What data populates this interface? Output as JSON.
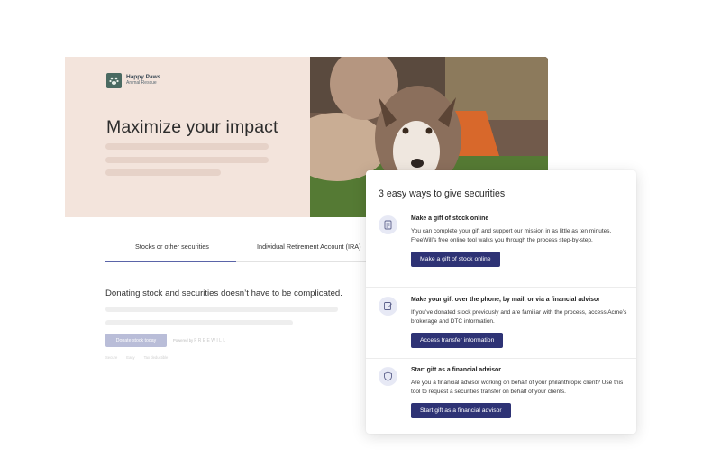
{
  "brand": {
    "name": "Happy Paws",
    "sub": "Animal Rescue"
  },
  "hero": {
    "title": "Maximize your impact"
  },
  "tabs": [
    {
      "label": "Stocks or other securities"
    },
    {
      "label": "Individual Retirement Account (IRA)"
    }
  ],
  "main": {
    "intro": "Donating stock and securities doesn’t have to be complicated.",
    "donate_button": "Donate stock today",
    "powered_prefix": "Powered by",
    "powered_brand": "FREEWILL",
    "footer_links": [
      "Secure",
      "Easy",
      "Tax deductible"
    ]
  },
  "panel": {
    "title": "3 easy ways to give securities",
    "items": [
      {
        "icon": "document-stock-icon",
        "heading": "Make a gift of stock online",
        "description": "You can complete your gift and support our mission in as little as ten minutes. FreeWill’s free online tool walks you through the process step-by-step.",
        "button": "Make a gift of stock online"
      },
      {
        "icon": "edit-document-icon",
        "heading": "Make your gift over the phone, by mail, or via a financial advisor",
        "description": "If you’ve donated stock previously and are familiar with the process, access Acme’s brokerage and DTC information.",
        "button": "Access transfer information"
      },
      {
        "icon": "shield-dollar-icon",
        "heading": "Start gift as a financial advisor",
        "description": "Are you a financial advisor working on behalf of your philanthropic client? Use this tool to request a securities transfer on behalf of your clients.",
        "button": "Start gift as a financial advisor"
      }
    ]
  },
  "colors": {
    "hero_bg": "#f3e4dc",
    "accent": "#2e3375",
    "tab_active": "#5a64a8",
    "icon_bg": "#e7e9f5"
  }
}
